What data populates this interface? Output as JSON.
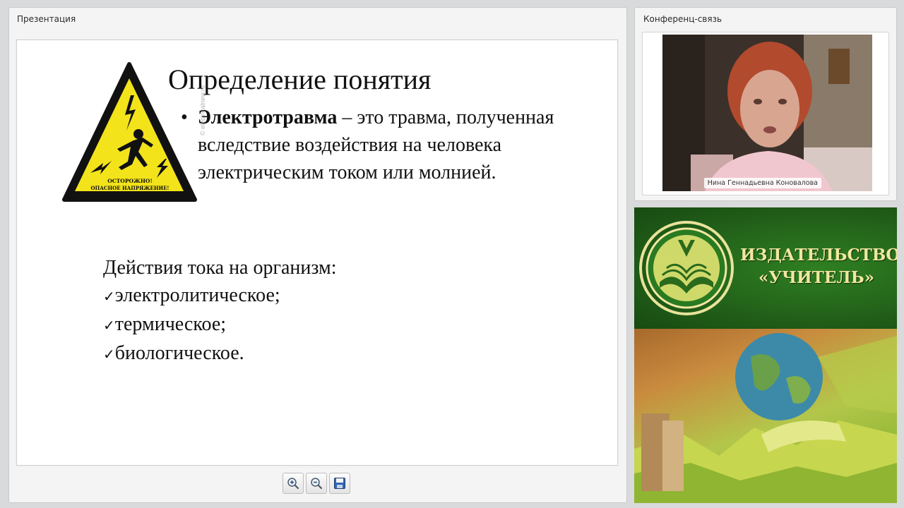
{
  "presentation": {
    "title": "Презентация",
    "slide": {
      "heading": "Определение понятия",
      "bullet_term": "Электротравма",
      "bullet_rest": " – это травма, полученная вследствие воздействия на человека электрическим током или молнией.",
      "sign_line1": "ОСТОРОЖНО!",
      "sign_line2": "ОПАСНОЕ НАПРЯЖЕНИЕ!",
      "watermark": "© electricalnew.ru",
      "effects_title": "Действия тока на организм:",
      "effects": [
        "электролитическое;",
        "термическое;",
        "биологическое."
      ]
    },
    "toolbar": [
      "zoom-in-icon",
      "zoom-out-icon",
      "save-icon"
    ]
  },
  "conference": {
    "title": "Конференц-связь",
    "participant_name": "Нина Геннадьевна Коновалова"
  },
  "banner": {
    "line1": "ИЗДАТЕЛЬСТВО",
    "line2": "«УЧИТЕЛЬ»"
  }
}
